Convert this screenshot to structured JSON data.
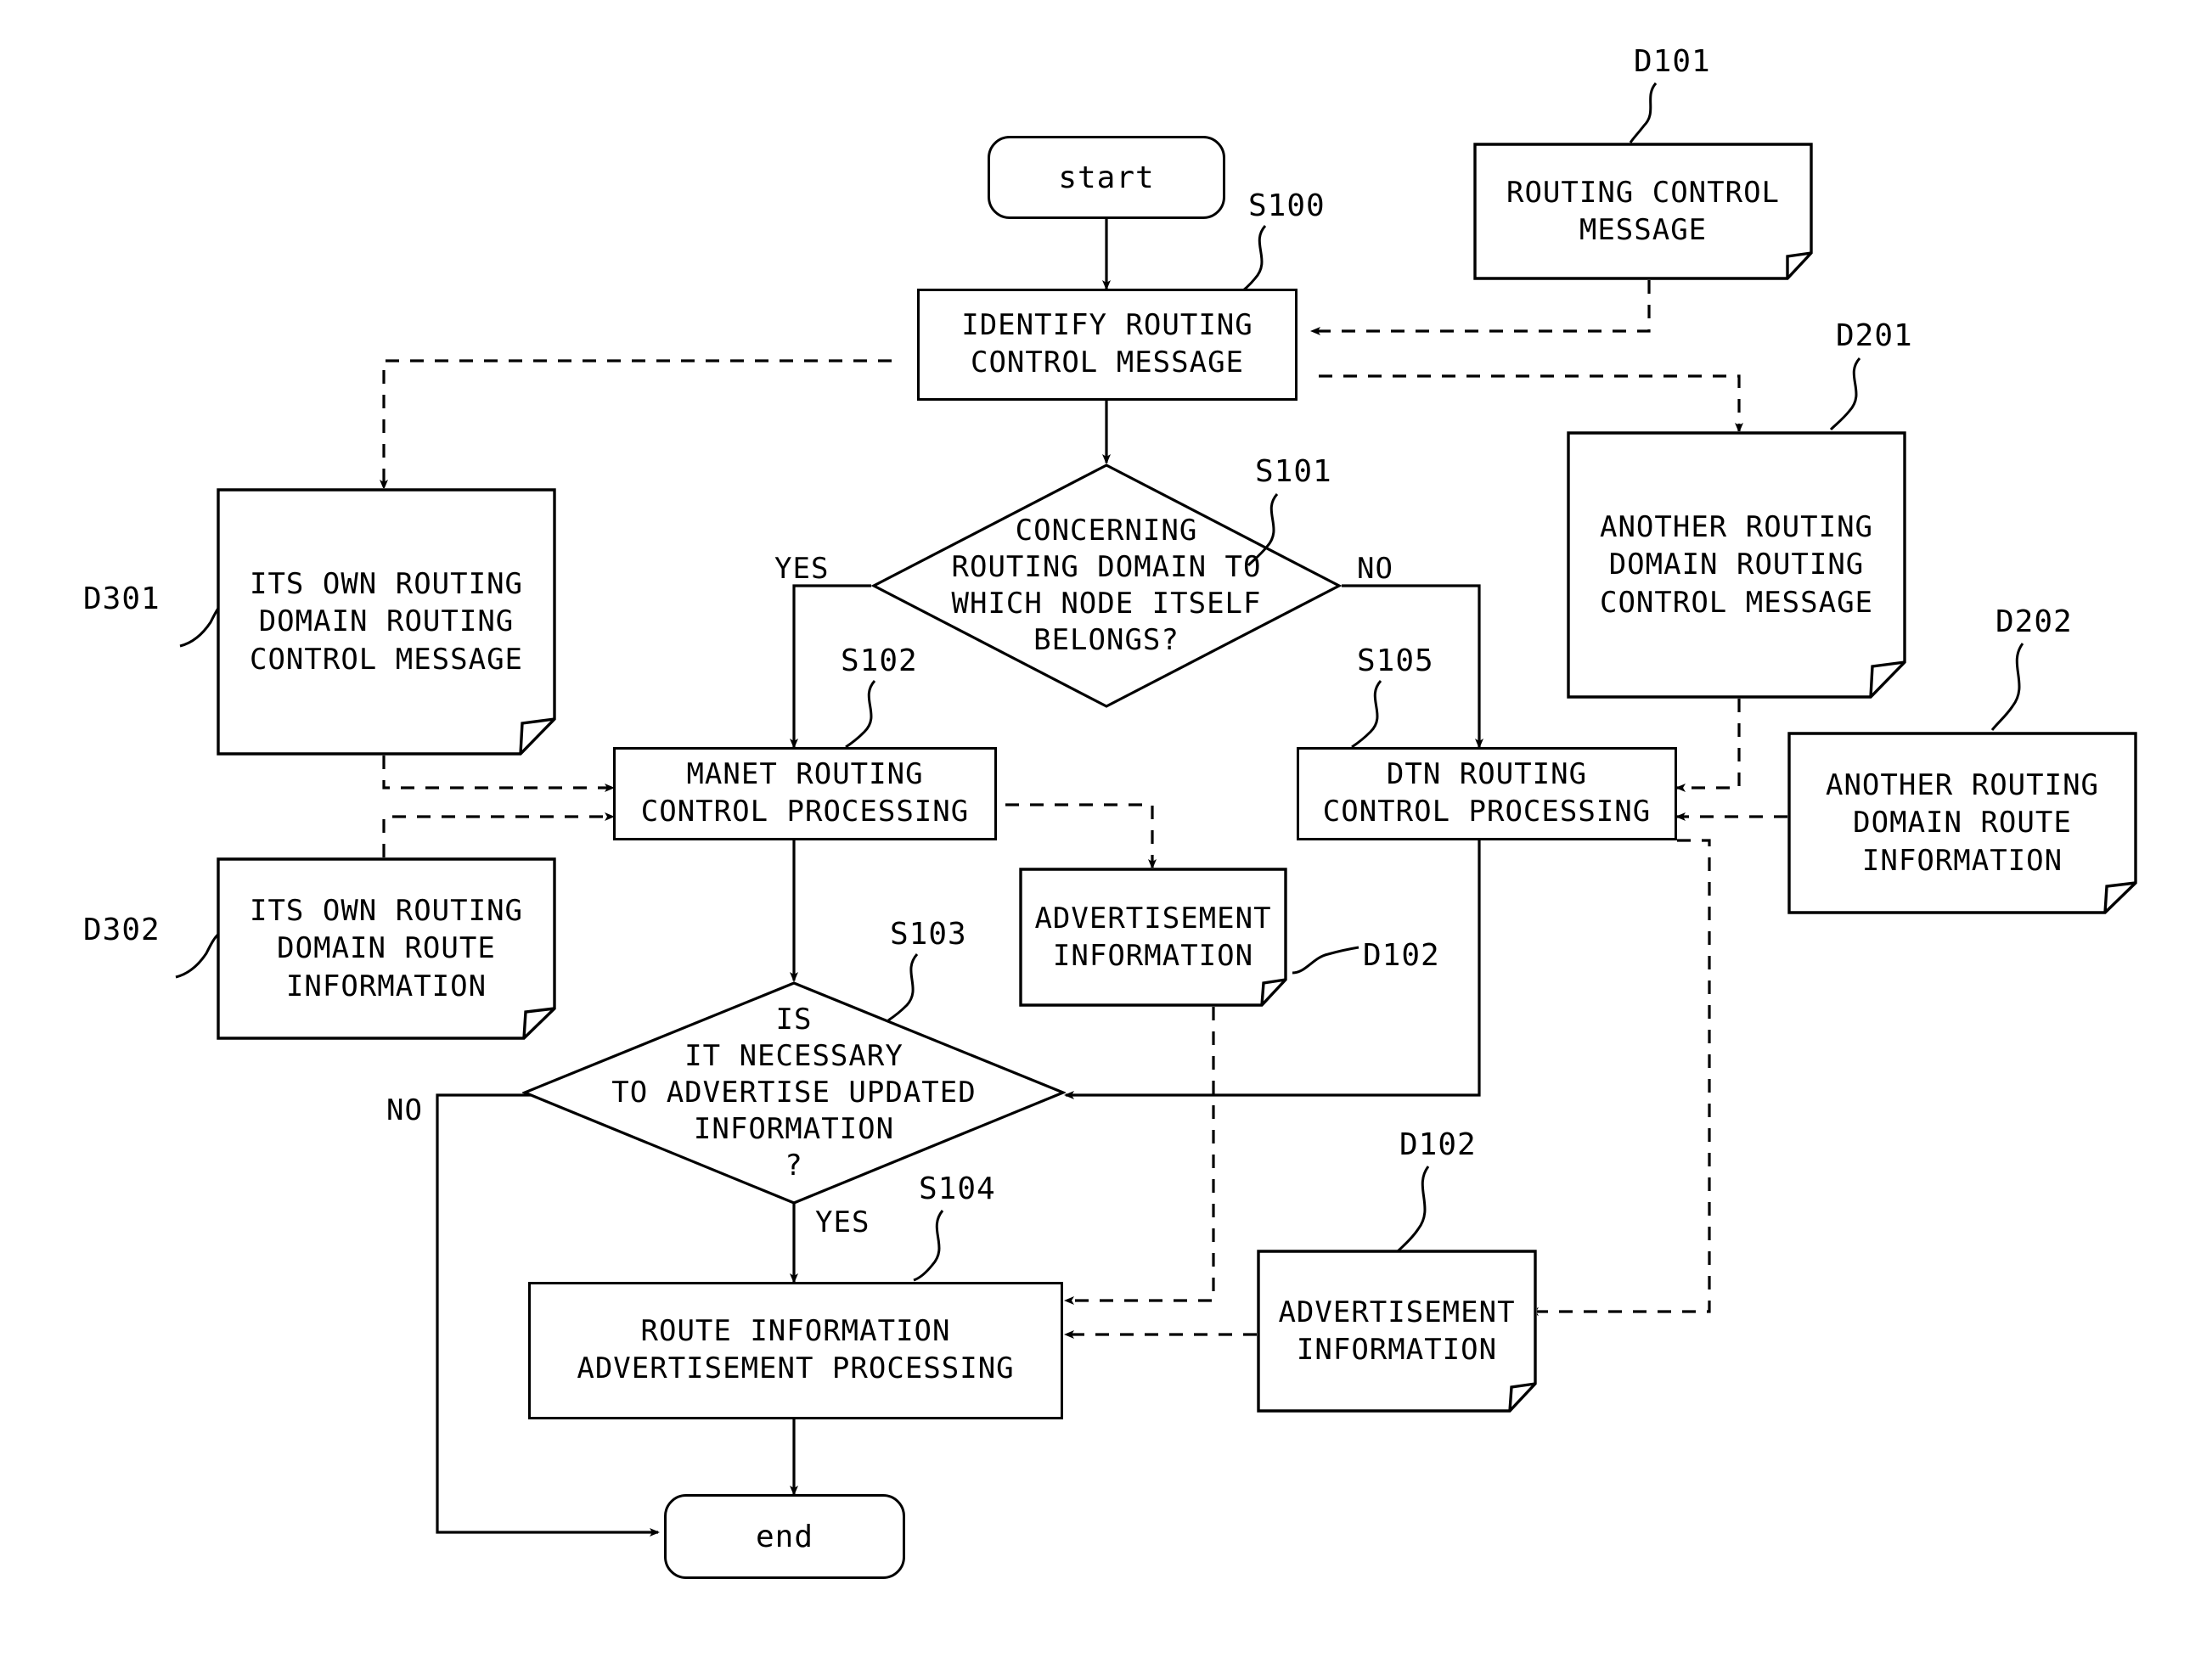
{
  "diagram": {
    "type": "flowchart",
    "nodes": {
      "start": {
        "label": "start",
        "tag": "S100"
      },
      "identify": {
        "label": "IDENTIFY ROUTING\nCONTROL MESSAGE",
        "tag": "S100"
      },
      "d101": {
        "label": "ROUTING CONTROL\nMESSAGE",
        "tag": "D101"
      },
      "decision_domain": {
        "label": "CONCERNING\nROUTING DOMAIN TO\nWHICH NODE ITSELF\nBELONGS?",
        "tag": "S101",
        "yes": "YES",
        "no": "NO"
      },
      "d301": {
        "label": "ITS OWN ROUTING\nDOMAIN ROUTING\nCONTROL MESSAGE",
        "tag": "D301"
      },
      "d302": {
        "label": "ITS OWN ROUTING\nDOMAIN ROUTE\nINFORMATION",
        "tag": "D302"
      },
      "manet": {
        "label": "MANET ROUTING\nCONTROL PROCESSING",
        "tag": "S102"
      },
      "dtn": {
        "label": "DTN ROUTING\nCONTROL PROCESSING",
        "tag": "S105"
      },
      "d201": {
        "label": "ANOTHER ROUTING\nDOMAIN ROUTING\nCONTROL MESSAGE",
        "tag": "D201"
      },
      "d202": {
        "label": "ANOTHER ROUTING\nDOMAIN ROUTE\nINFORMATION",
        "tag": "D202"
      },
      "d102_upper": {
        "label": "ADVERTISEMENT\nINFORMATION",
        "tag": "D102"
      },
      "d102_lower": {
        "label": "ADVERTISEMENT\nINFORMATION",
        "tag": "D102"
      },
      "decision_advertise": {
        "label": "IS\nIT NECESSARY\nTO ADVERTISE UPDATED\nINFORMATION\n?",
        "tag": "S103",
        "yes": "YES",
        "no": "NO",
        "yes_tag": "S104"
      },
      "advert_proc": {
        "label": "ROUTE INFORMATION\nADVERTISEMENT PROCESSING",
        "tag": "S104"
      },
      "end": {
        "label": "end"
      }
    },
    "step_tags": [
      "S100",
      "S101",
      "S102",
      "S103",
      "S104",
      "S105"
    ],
    "data_tags": [
      "D101",
      "D102",
      "D201",
      "D202",
      "D301",
      "D302"
    ],
    "branch_labels": {
      "yes": "YES",
      "no": "NO"
    },
    "colors": {
      "stroke": "#000000",
      "fill": "#ffffff"
    }
  }
}
